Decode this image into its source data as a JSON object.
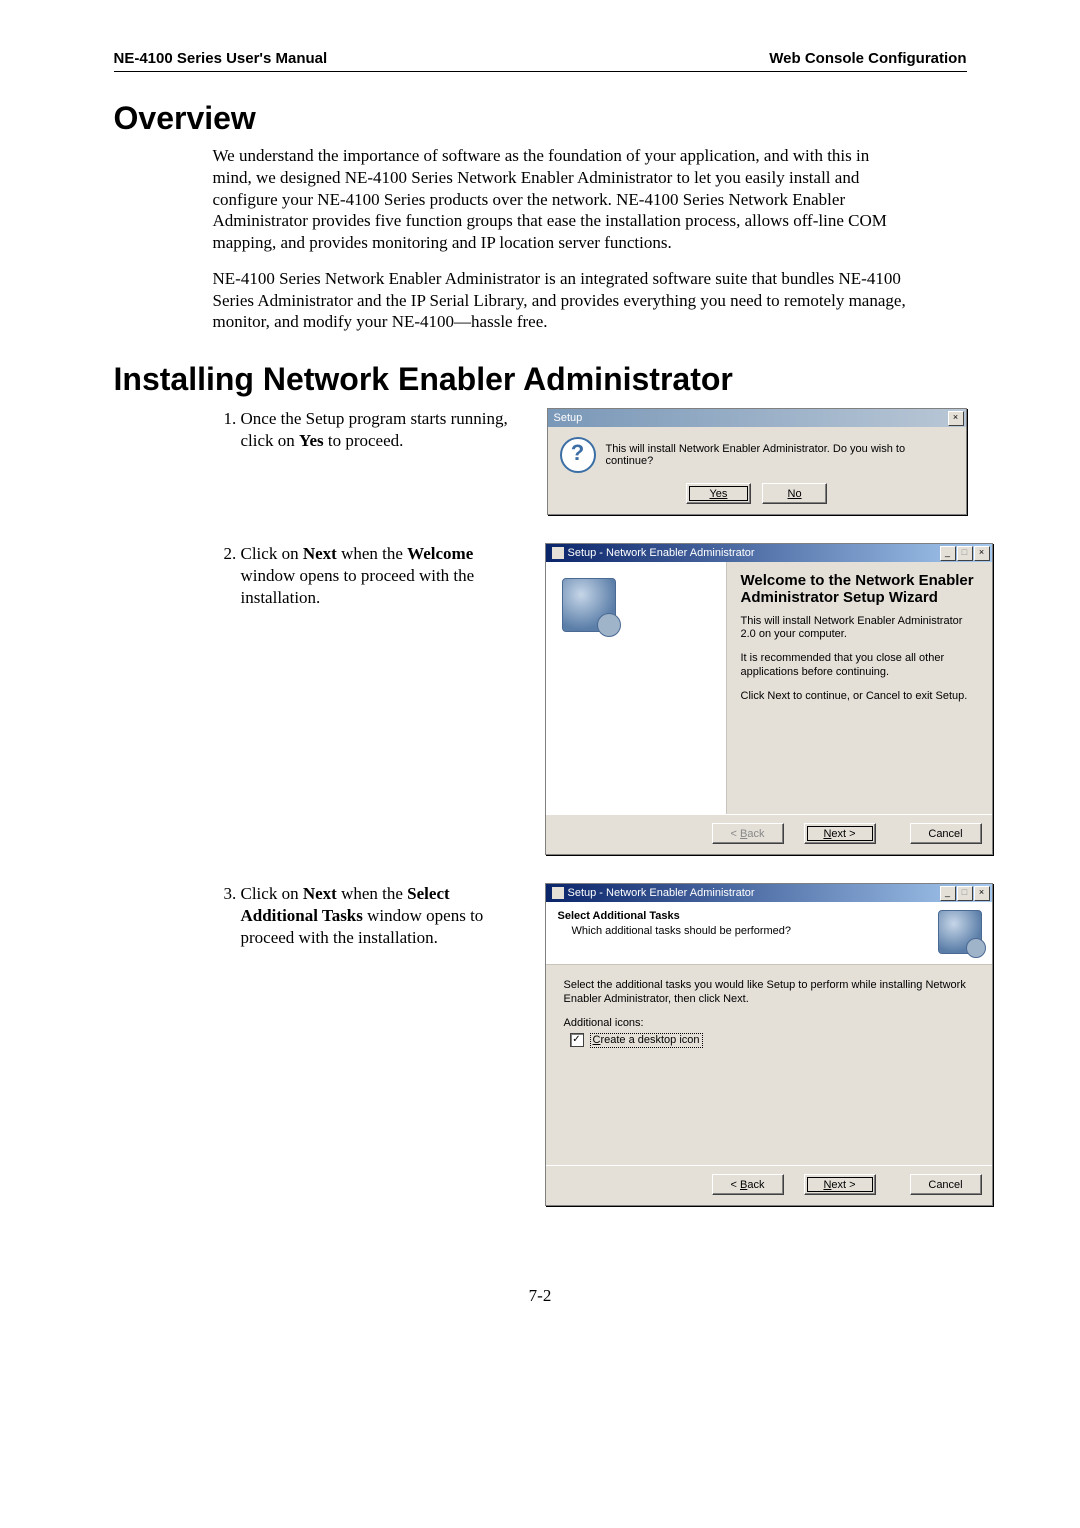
{
  "header": {
    "left": "NE-4100 Series User's Manual",
    "right": "Web Console Configuration"
  },
  "section1": {
    "title": "Overview",
    "p1": "We understand the importance of software as the foundation of your application, and with this in mind, we designed NE-4100 Series Network Enabler Administrator to let you easily install and configure your NE-4100 Series products over the network. NE-4100 Series Network Enabler Administrator provides five function groups that ease the installation process, allows off-line COM mapping, and provides monitoring and IP location server functions.",
    "p2": "NE-4100 Series Network Enabler Administrator is an integrated software suite that bundles NE-4100 Series Administrator and the IP Serial Library, and provides everything you need to remotely manage, monitor, and modify your NE-4100—hassle free."
  },
  "section2": {
    "title": "Installing Network Enabler Administrator",
    "step1_prefix": "Once the Setup program starts running, click on ",
    "step1_bold": "Yes",
    "step1_suffix": " to proceed.",
    "step2_a": "Click on ",
    "step2_b": "Next",
    "step2_c": " when the ",
    "step2_d": "Welcome",
    "step2_e": " window opens to proceed with the installation.",
    "step3_a": "Click on ",
    "step3_b": "Next",
    "step3_c": " when the ",
    "step3_d": "Select Additional Tasks",
    "step3_e": " window opens to proceed with the installation."
  },
  "dlg1": {
    "title": "Setup",
    "msg": "This will install Network Enabler Administrator. Do you wish to continue?",
    "yes": "Yes",
    "no": "No",
    "close": "×"
  },
  "dlg2": {
    "title": "Setup - Network Enabler Administrator",
    "wiztitle": "Welcome to the Network Enabler Administrator Setup Wizard",
    "line1": "This will install Network Enabler Administrator 2.0 on your computer.",
    "line2": "It is recommended that you close all other applications before continuing.",
    "line3": "Click Next to continue, or Cancel to exit Setup.",
    "back_u": "B",
    "back_rest": "ack",
    "next_u": "N",
    "next_rest": "ext >",
    "cancel": "Cancel",
    "min": "_",
    "max": "□",
    "close": "×"
  },
  "dlg3": {
    "title": "Setup - Network Enabler Administrator",
    "htitle": "Select Additional Tasks",
    "hsub": "Which additional tasks should be performed?",
    "lead": "Select the additional tasks you would like Setup to perform while installing Network Enabler Administrator, then click Next.",
    "grouplabel": "Additional icons:",
    "checkbox_mark": "✓",
    "checkbox_u": "C",
    "checkbox_rest": "reate a desktop icon",
    "back_lt": "< ",
    "back_u": "B",
    "back_rest": "ack",
    "next_u": "N",
    "next_rest": "ext >",
    "cancel": "Cancel",
    "min": "_",
    "max": "□",
    "close": "×"
  },
  "page_number": "7-2"
}
